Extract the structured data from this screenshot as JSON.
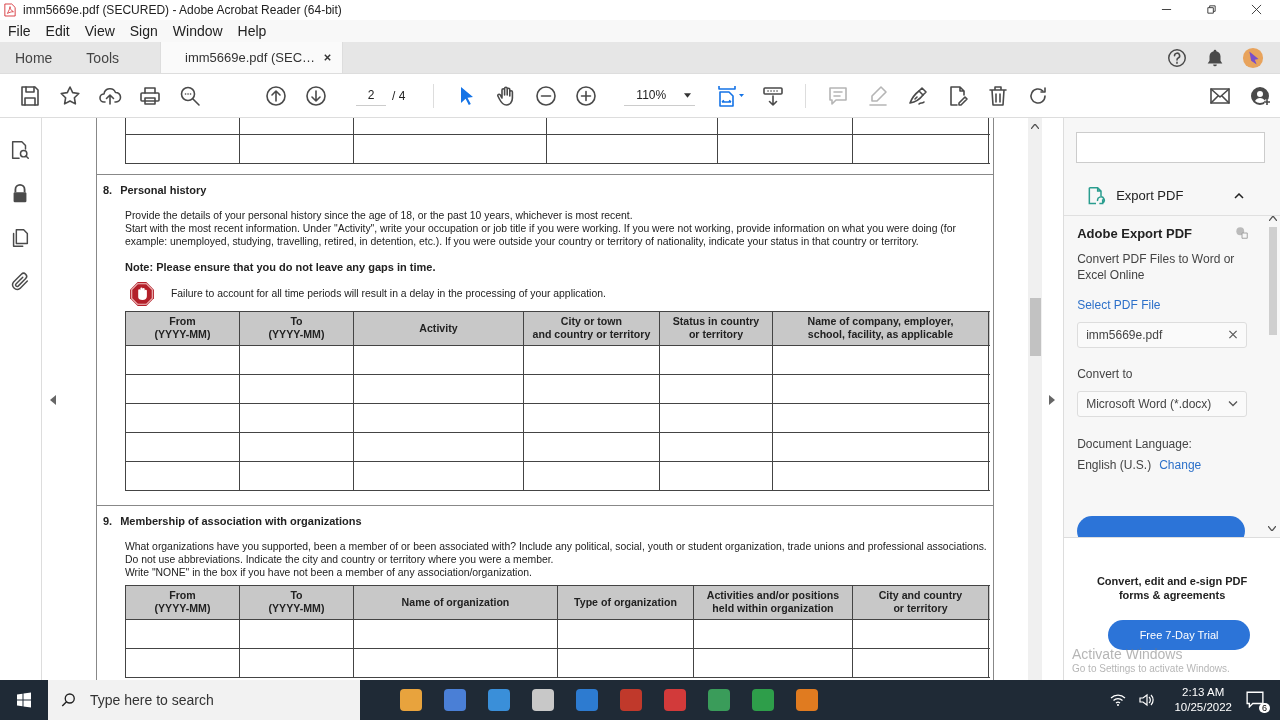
{
  "window": {
    "title": "imm5669e.pdf (SECURED) - Adobe Acrobat Reader (64-bit)"
  },
  "menu": [
    "File",
    "Edit",
    "View",
    "Sign",
    "Window",
    "Help"
  ],
  "tabs": [
    {
      "label": "Home",
      "selected": false
    },
    {
      "label": "Tools",
      "selected": false
    },
    {
      "label": "imm5669e.pdf (SEC…",
      "selected": true
    }
  ],
  "toolbar": {
    "page": "2",
    "page_count": "/ 4",
    "zoom": "110%"
  },
  "document": {
    "sections": [
      {
        "number": "8.",
        "title": "Personal history",
        "paragraphs": [
          "Provide the details of your personal history since the age of 18, or the past 10 years, whichever is most recent.",
          "Start with the most recent information. Under \"Activity\", write your occupation or job title if you were working. If you were not working, provide information on what you were doing (for example: unemployed, studying, travelling, retired, in detention, etc.). If you were outside your country or territory of nationality, indicate your status in that country or territory."
        ],
        "note": "Note: Please ensure that you do not leave any gaps in time.",
        "warning": "Failure to account for all time periods will result in a delay in the processing of your application.",
        "columns": [
          "From\n(YYYY-MM)",
          "To\n(YYYY-MM)",
          "Activity",
          "City or town\nand country or territory",
          "Status in country\nor territory",
          "Name of company, employer,\nschool, facility, as applicable"
        ]
      },
      {
        "number": "9.",
        "title": "Membership of association with organizations",
        "paragraphs": [
          "What organizations have you supported, been a member of or been associated with? Include any political, social, youth or student organization, trade unions and professional associations. Do not use abbreviations. Indicate the city and country or territory where you were a member.",
          "Write \"NONE\" in the box if you have not been a member of any association/organization."
        ],
        "columns": [
          "From\n(YYYY-MM)",
          "To\n(YYYY-MM)",
          "Name of organization",
          "Type of organization",
          "Activities and/or positions\nheld within organization",
          "City and country\nor territory"
        ]
      }
    ]
  },
  "panel": {
    "tool": {
      "label": "Export PDF",
      "expanded": true
    },
    "heading": "Adobe Export PDF",
    "description": "Convert PDF Files to Word or Excel Online",
    "select_label": "Select PDF File",
    "file": "imm5669e.pdf",
    "convert_label": "Convert to",
    "format": "Microsoft Word (*.docx)",
    "language_label": "Document Language:",
    "language": "English (U.S.)",
    "change_link": "Change",
    "promo": "Convert, edit and e-sign PDF forms & agreements",
    "trial_button": "Free 7-Day Trial"
  },
  "overlay": {
    "title": "Activate Windows",
    "hint": "Go to Settings to activate Windows."
  },
  "taskbar": {
    "search_placeholder": "Type here to search",
    "time": "2:13 AM",
    "date": "10/25/2022",
    "notifications": "6"
  }
}
